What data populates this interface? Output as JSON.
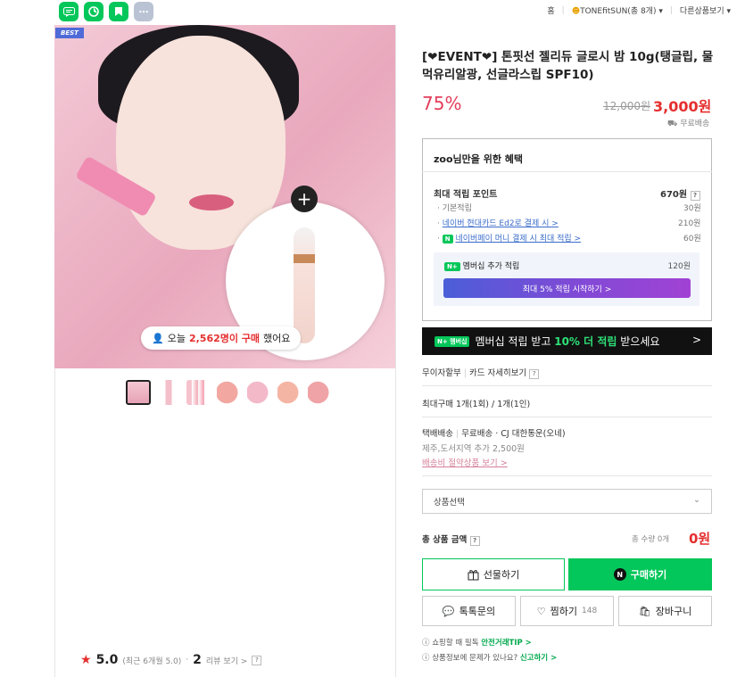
{
  "top_icons": [
    {
      "name": "talk",
      "color": "#03c75a",
      "glyph": "≡"
    },
    {
      "name": "cafe",
      "color": "#03c75a",
      "glyph": "◔"
    },
    {
      "name": "bookmark",
      "color": "#03c75a",
      "glyph": "⬆"
    },
    {
      "name": "more",
      "color": "#b9c3d3",
      "glyph": "⋯"
    }
  ],
  "topnav": {
    "home": "홈",
    "store": "TONEfitSUN(총 8개)",
    "other": "다른상품보기"
  },
  "gallery": {
    "badge": "BEST",
    "pill_prefix": "오늘",
    "pill_count": "2,562명이 구매",
    "pill_suffix": "했어요"
  },
  "rating": {
    "score": "5.0",
    "recent": "(최근 6개월 5.0)",
    "review_count": "2",
    "review_label": "리뷰 보기 >",
    "help": "?"
  },
  "product": {
    "title": "[❤EVENT❤] 톤핏선 젤리듀 글로시 밤 10g(탱글립, 물먹유리알광, 선글라스립 SPF10)",
    "discount": "75%",
    "original_price": "12,000원",
    "price": "3,000원",
    "shipping": "무료배송"
  },
  "benefit": {
    "heading": "zoo님만을 위한 혜택",
    "max_points_label": "최대 적립 포인트",
    "max_points_value": "670원",
    "rows": [
      {
        "label": "기본적립",
        "value": "30원"
      },
      {
        "label": "네이버 현대카드 Ed2로 결제 시 >",
        "value": "210원"
      },
      {
        "label": "네이버페이 머니 결제 시 최대 적립 >",
        "value": "60원"
      }
    ],
    "membership_label": "멤버십 추가 적립",
    "membership_value": "120원",
    "membership_button": "최대 5% 적립 시작하기 >",
    "npay_tag": "N+",
    "npay_badge": "N"
  },
  "banner": {
    "tag": "N+ 멤버십",
    "text1": "멤버십 적립 받고",
    "text2": "10% 더 적립",
    "text3": "받으세요",
    "arrow": ">"
  },
  "details": {
    "installment": "무이자할부",
    "card": "카드 자세히보기",
    "max_buy": "최대구매 1개(1회) / 1개(1인)",
    "delivery_label": "택배배송",
    "delivery_value": "무료배송 · CJ 대한통운(오네)",
    "jeju": "제주,도서지역 추가 2,500원",
    "saving_link": "배송비 절약상품 보기 >"
  },
  "select": {
    "placeholder": "상품선택",
    "chevron": "⌄"
  },
  "total": {
    "label": "총 상품 금액",
    "help": "?",
    "qty": "총 수량 0개",
    "amount": "0원"
  },
  "buttons": {
    "gift": "선물하기",
    "buy": "구매하기",
    "talk": "톡톡문의",
    "wish": "찜하기",
    "wish_count": "148",
    "cart": "장바구니"
  },
  "footer": {
    "line1_text": "쇼핑할 때 필독",
    "line1_link": "안전거래TIP >",
    "line2_text": "상품정보에 문제가 있나요?",
    "line2_link": "신고하기 >"
  },
  "colors": {
    "accent": "#03c75a",
    "price": "#e52e2e",
    "discount": "#e33d5a",
    "link": "#3a6cc9"
  }
}
